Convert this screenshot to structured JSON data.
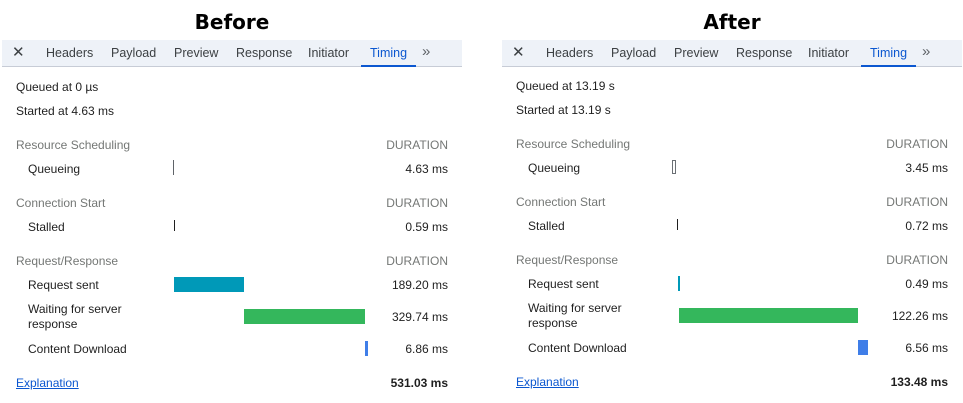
{
  "before": {
    "title": "Before",
    "tabs": [
      "Headers",
      "Payload",
      "Preview",
      "Response",
      "Initiator",
      "Timing"
    ],
    "queued_at": "Queued at 0 µs",
    "started_at": "Started at 4.63 ms",
    "duration_header": "DURATION",
    "resource_scheduling": {
      "title": "Resource Scheduling",
      "queueing_label": "Queueing",
      "queueing_value": "4.63 ms"
    },
    "connection_start": {
      "title": "Connection Start",
      "stalled_label": "Stalled",
      "stalled_value": "0.59 ms"
    },
    "request_response": {
      "title": "Request/Response",
      "request_sent_label": "Request sent",
      "request_sent_value": "189.20 ms",
      "waiting_label": "Waiting for server response",
      "waiting_value": "329.74 ms",
      "download_label": "Content Download",
      "download_value": "6.86 ms"
    },
    "explanation": "Explanation",
    "total": "531.03 ms"
  },
  "after": {
    "title": "After",
    "tabs": [
      "Headers",
      "Payload",
      "Preview",
      "Response",
      "Initiator",
      "Timing"
    ],
    "queued_at": "Queued at 13.19 s",
    "started_at": "Started at 13.19 s",
    "duration_header": "DURATION",
    "resource_scheduling": {
      "title": "Resource Scheduling",
      "queueing_label": "Queueing",
      "queueing_value": "3.45 ms"
    },
    "connection_start": {
      "title": "Connection Start",
      "stalled_label": "Stalled",
      "stalled_value": "0.72 ms"
    },
    "request_response": {
      "title": "Request/Response",
      "request_sent_label": "Request sent",
      "request_sent_value": "0.49 ms",
      "waiting_label": "Waiting for server response",
      "waiting_value": "122.26 ms",
      "download_label": "Content Download",
      "download_value": "6.56 ms"
    },
    "explanation": "Explanation",
    "total": "133.48 ms"
  },
  "colors": {
    "request_sent_bar": "#0099b8",
    "waiting_bar": "#34b75c",
    "download_bar": "#3f7ee8",
    "active_tab": "#0b57d0"
  }
}
